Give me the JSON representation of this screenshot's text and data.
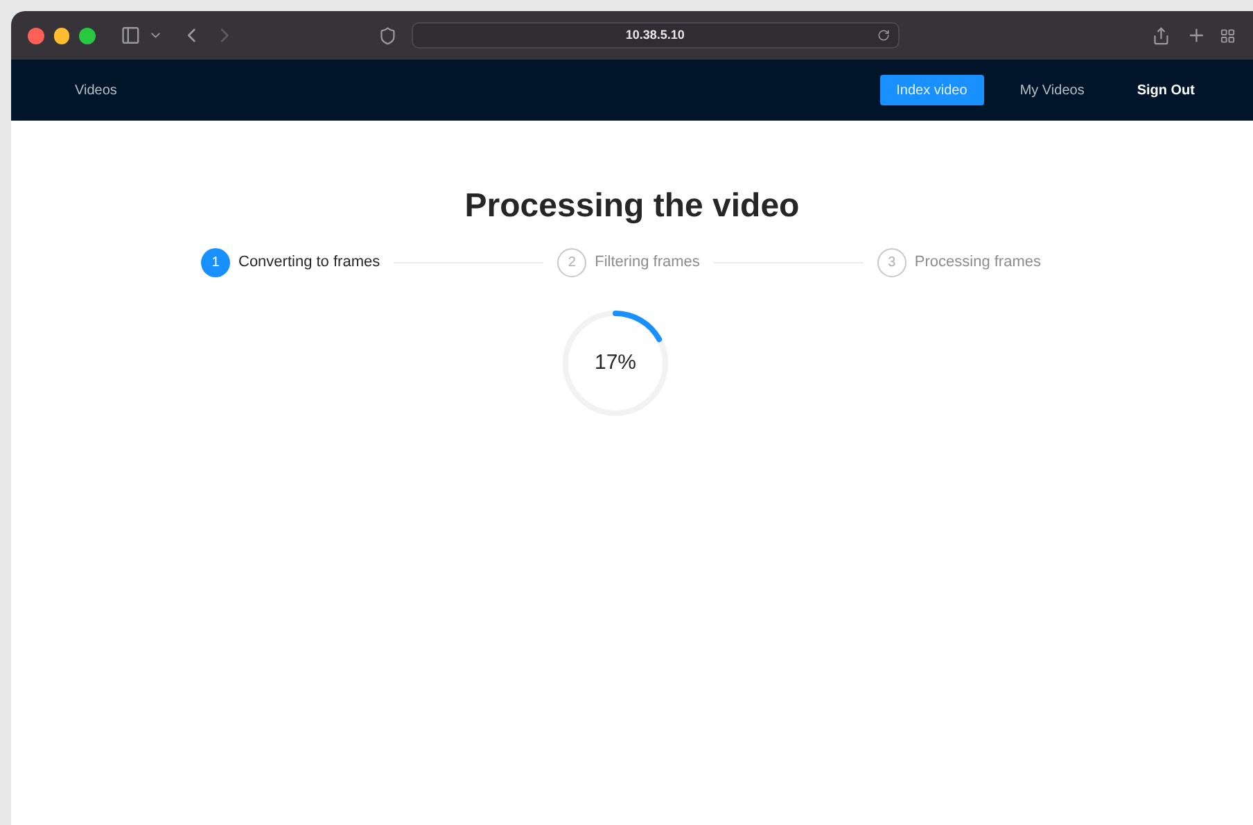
{
  "browser": {
    "address": "10.38.5.10"
  },
  "nav": {
    "brand": "Videos",
    "items": [
      {
        "label": "Index video",
        "selected": true
      },
      {
        "label": "My Videos",
        "selected": false
      },
      {
        "label": "Sign Out",
        "selected": false
      }
    ]
  },
  "title": "Processing the video",
  "steps": [
    {
      "number": "1",
      "label": "Converting to frames",
      "selected": true
    },
    {
      "number": "2",
      "label": "Filtering frames",
      "selected": false
    },
    {
      "number": "3",
      "label": "Processing frames",
      "selected": false
    }
  ],
  "progress": {
    "level": 0.17,
    "reading": "17%"
  }
}
